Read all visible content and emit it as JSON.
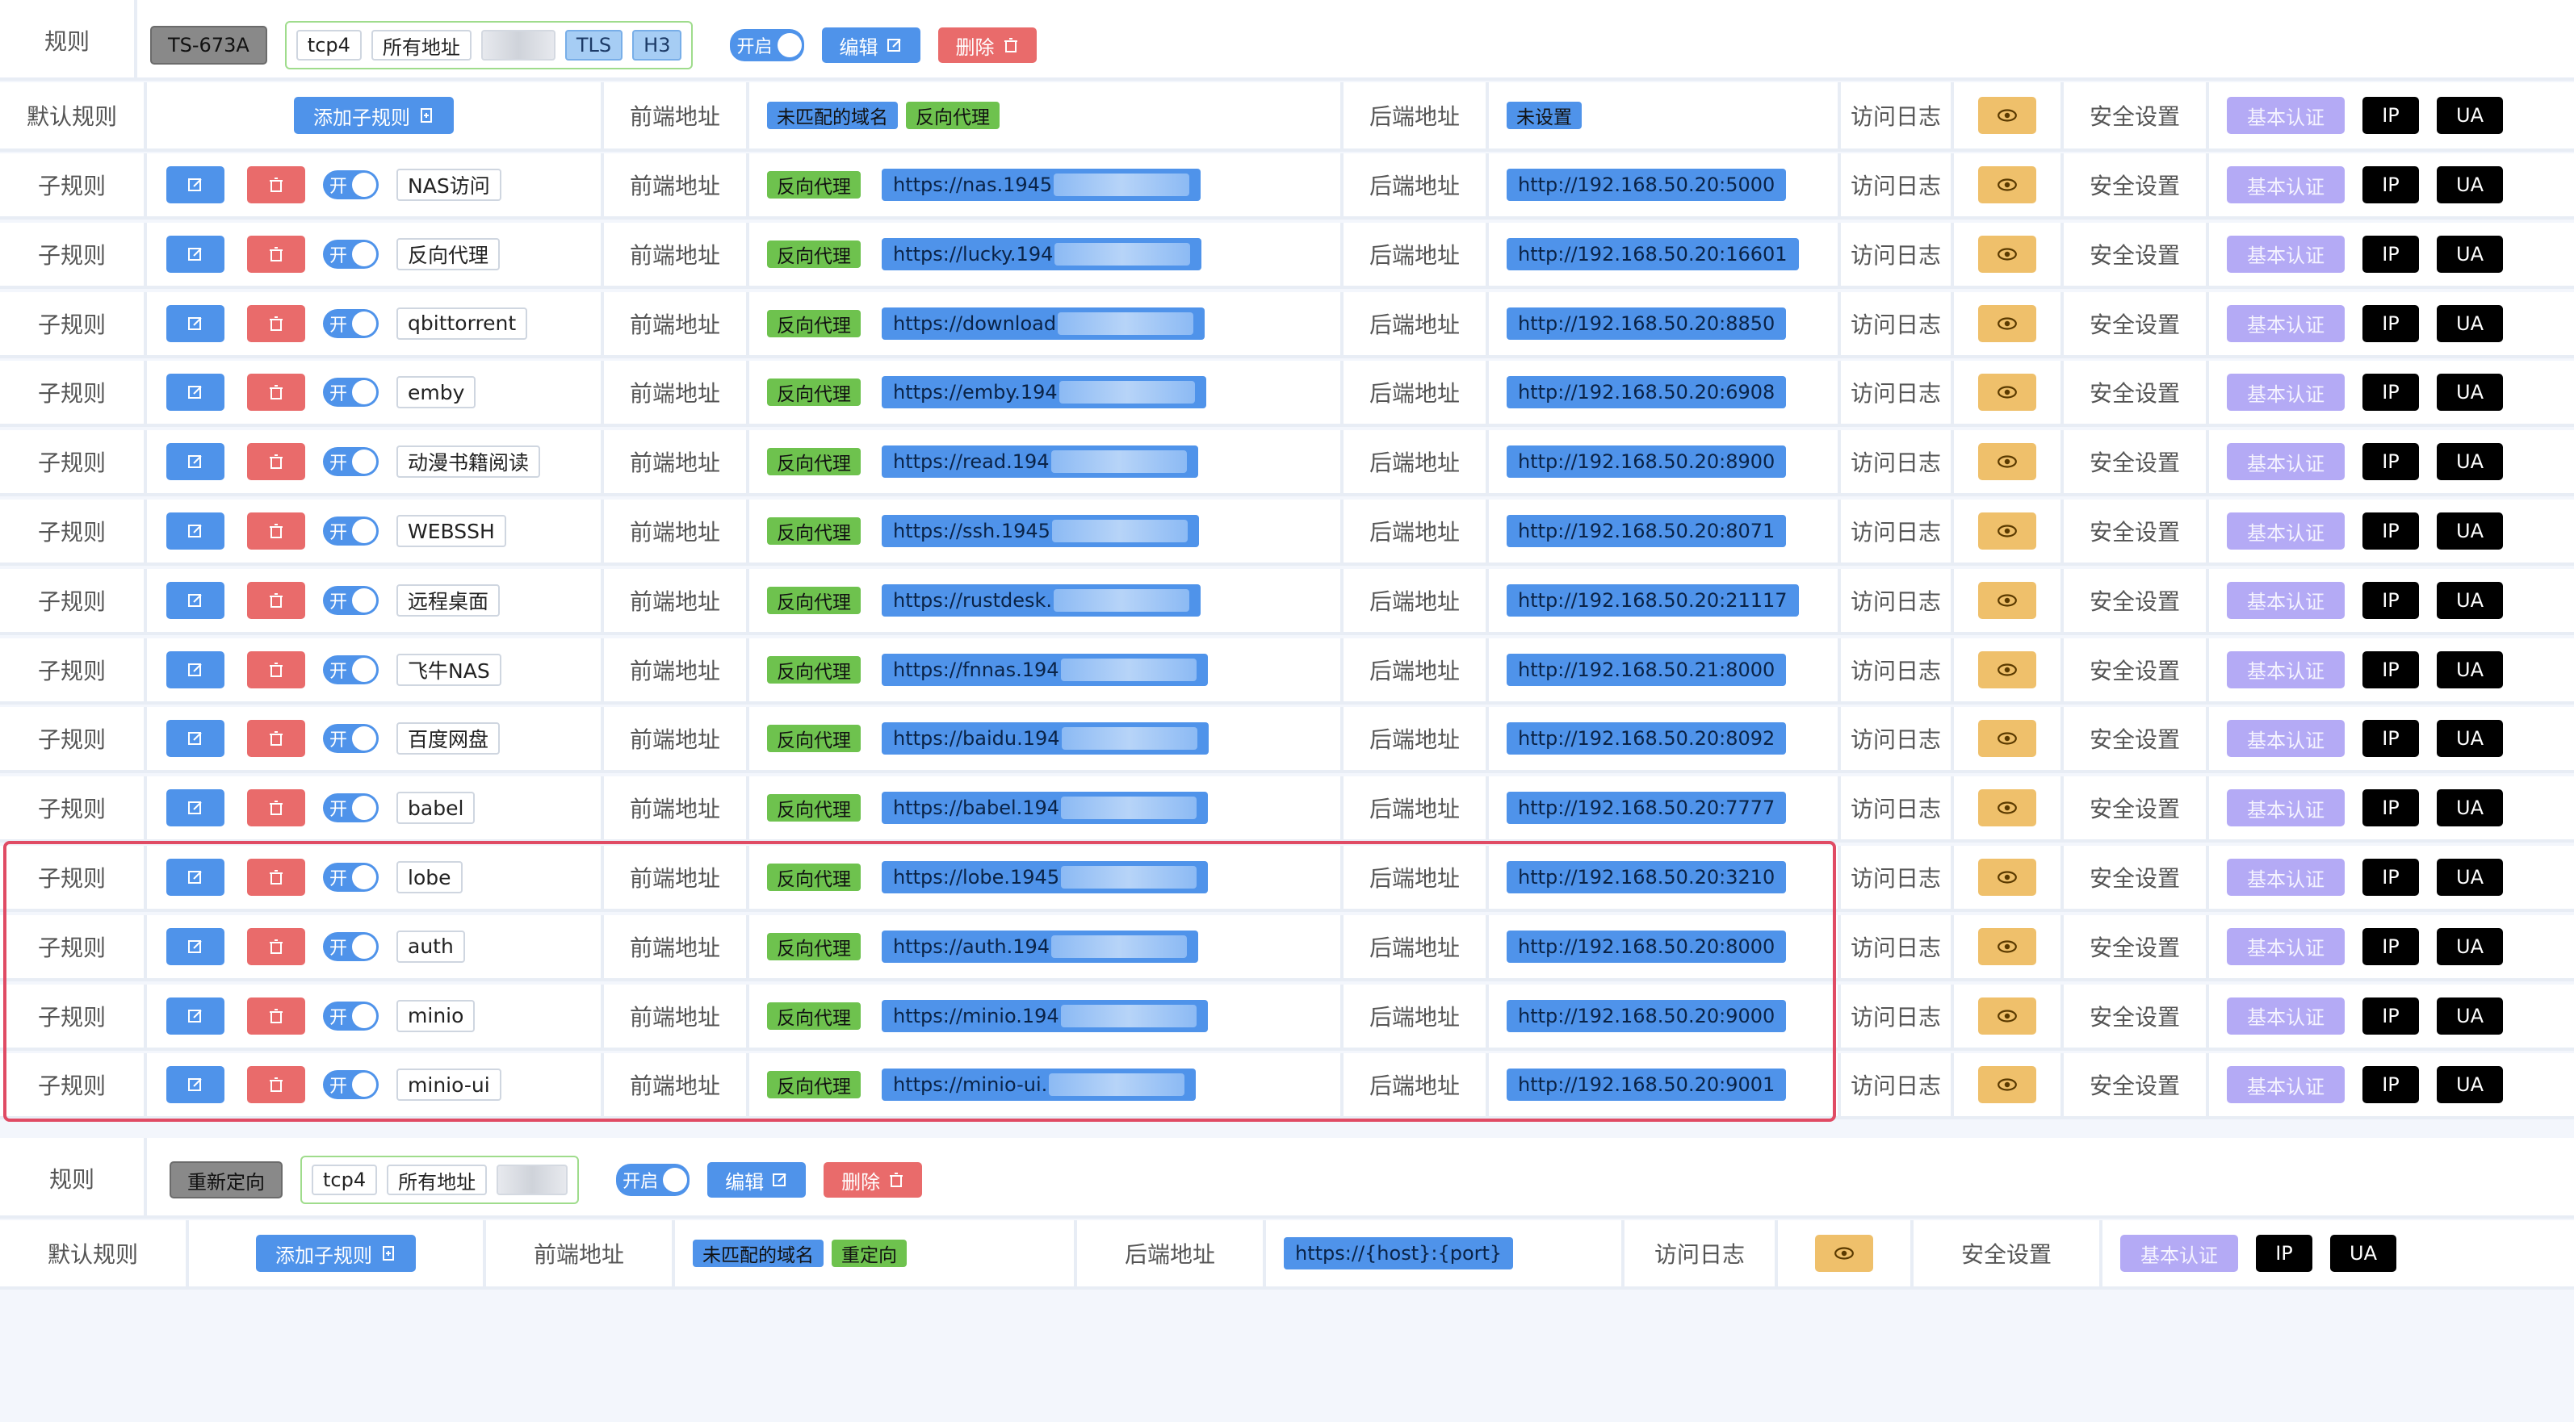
{
  "rule1": {
    "header": {
      "label": "规则",
      "device": "TS-673A",
      "protocol": "tcp4",
      "address": "所有地址",
      "port": "",
      "tls": "TLS",
      "h3": "H3",
      "switch_label": "开启",
      "edit_label": "编辑",
      "delete_label": "删除"
    },
    "default_row": {
      "label": "默认规则",
      "add_label": "添加子规则",
      "frontend_label": "前端地址",
      "unmatched_tag": "未匹配的域名",
      "proxy_tag": "反向代理",
      "backend_label": "后端地址",
      "backend_value": "未设置",
      "log_label": "访问日志",
      "security_label": "安全设置",
      "basic_auth": "基本认证",
      "ip": "IP",
      "ua": "UA"
    },
    "sub_rules": [
      {
        "name": "NAS访问",
        "frontend": "https://nas.1945",
        "backend": "http://192.168.50.20:5000"
      },
      {
        "name": "反向代理",
        "frontend": "https://lucky.194",
        "backend": "http://192.168.50.20:16601"
      },
      {
        "name": "qbittorrent",
        "frontend": "https://download",
        "backend": "http://192.168.50.20:8850"
      },
      {
        "name": "emby",
        "frontend": "https://emby.194",
        "backend": "http://192.168.50.20:6908"
      },
      {
        "name": "动漫书籍阅读",
        "frontend": "https://read.194",
        "backend": "http://192.168.50.20:8900"
      },
      {
        "name": "WEBSSH",
        "frontend": "https://ssh.1945",
        "backend": "http://192.168.50.20:8071"
      },
      {
        "name": "远程桌面",
        "frontend": "https://rustdesk.",
        "backend": "http://192.168.50.20:21117"
      },
      {
        "name": "飞牛NAS",
        "frontend": "https://fnnas.194",
        "backend": "http://192.168.50.21:8000"
      },
      {
        "name": "百度网盘",
        "frontend": "https://baidu.194",
        "backend": "http://192.168.50.20:8092"
      },
      {
        "name": "babel",
        "frontend": "https://babel.194",
        "backend": "http://192.168.50.20:7777"
      },
      {
        "name": "lobe",
        "frontend": "https://lobe.1945",
        "backend": "http://192.168.50.20:3210"
      },
      {
        "name": "auth",
        "frontend": "https://auth.194",
        "backend": "http://192.168.50.20:8000"
      },
      {
        "name": "minio",
        "frontend": "https://minio.194",
        "backend": "http://192.168.50.20:9000"
      },
      {
        "name": "minio-ui",
        "frontend": "https://minio-ui.",
        "backend": "http://192.168.50.20:9001"
      }
    ],
    "sub_common": {
      "label": "子规则",
      "switch_label": "开",
      "frontend_label": "前端地址",
      "proxy_tag": "反向代理",
      "backend_label": "后端地址",
      "log_label": "访问日志",
      "security_label": "安全设置",
      "basic_auth": "基本认证",
      "ip": "IP",
      "ua": "UA"
    }
  },
  "rule2": {
    "header": {
      "label": "规则",
      "type": "重新定向",
      "protocol": "tcp4",
      "address": "所有地址",
      "port": "",
      "switch_label": "开启",
      "edit_label": "编辑",
      "delete_label": "删除"
    },
    "default_row": {
      "label": "默认规则",
      "add_label": "添加子规则",
      "frontend_label": "前端地址",
      "unmatched_tag": "未匹配的域名",
      "redirect_tag": "重定向",
      "backend_label": "后端地址",
      "backend_value": "https://{host}:{port}",
      "log_label": "访问日志",
      "security_label": "安全设置",
      "basic_auth": "基本认证",
      "ip": "IP",
      "ua": "UA"
    }
  }
}
